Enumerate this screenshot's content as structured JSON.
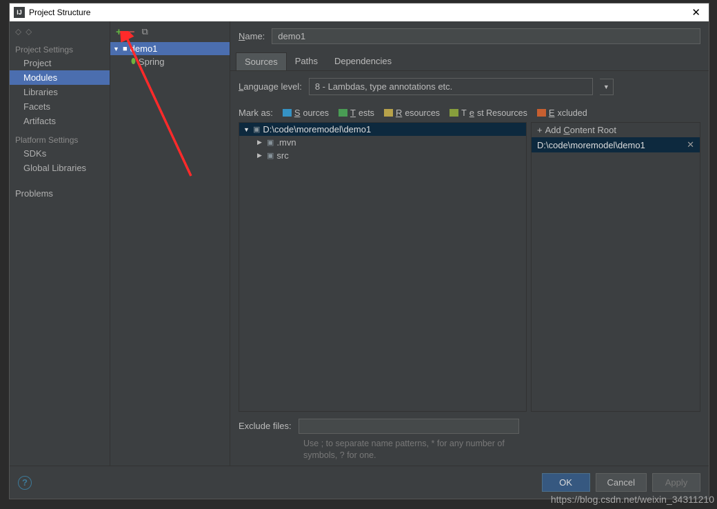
{
  "window": {
    "title": "Project Structure",
    "close": "✕"
  },
  "nav": {
    "projectSettings": "Project Settings",
    "items1": {
      "project": "Project",
      "modules": "Modules",
      "libraries": "Libraries",
      "facets": "Facets",
      "artifacts": "Artifacts"
    },
    "platformSettings": "Platform Settings",
    "items2": {
      "sdks": "SDKs",
      "globalLibs": "Global Libraries"
    },
    "problems": "Problems"
  },
  "moduleTree": {
    "root": "demo1",
    "child": "Spring"
  },
  "content": {
    "nameLabel": "Name:",
    "nameValue": "demo1",
    "tabs": {
      "sources": "Sources",
      "paths": "Paths",
      "dependencies": "Dependencies"
    },
    "languageLevelLabel": "Language level:",
    "languageLevelValue": "8 - Lambdas, type annotations etc.",
    "markAs": "Mark as:",
    "marks": {
      "sources": "Sources",
      "tests": "Tests",
      "resources": "Resources",
      "testResources": "Test Resources",
      "excluded": "Excluded"
    },
    "tree": {
      "root": "D:\\code\\moremodel\\demo1",
      "mvn": ".mvn",
      "src": "src"
    },
    "addContentRoot": "Add Content Root",
    "contentRootPath": "D:\\code\\moremodel\\demo1",
    "excludeLabel": "Exclude files:",
    "excludeHint": "Use ; to separate name patterns, * for any number of symbols, ? for one."
  },
  "footer": {
    "ok": "OK",
    "cancel": "Cancel",
    "apply": "Apply"
  },
  "watermark": "https://blog.csdn.net/weixin_34311210"
}
